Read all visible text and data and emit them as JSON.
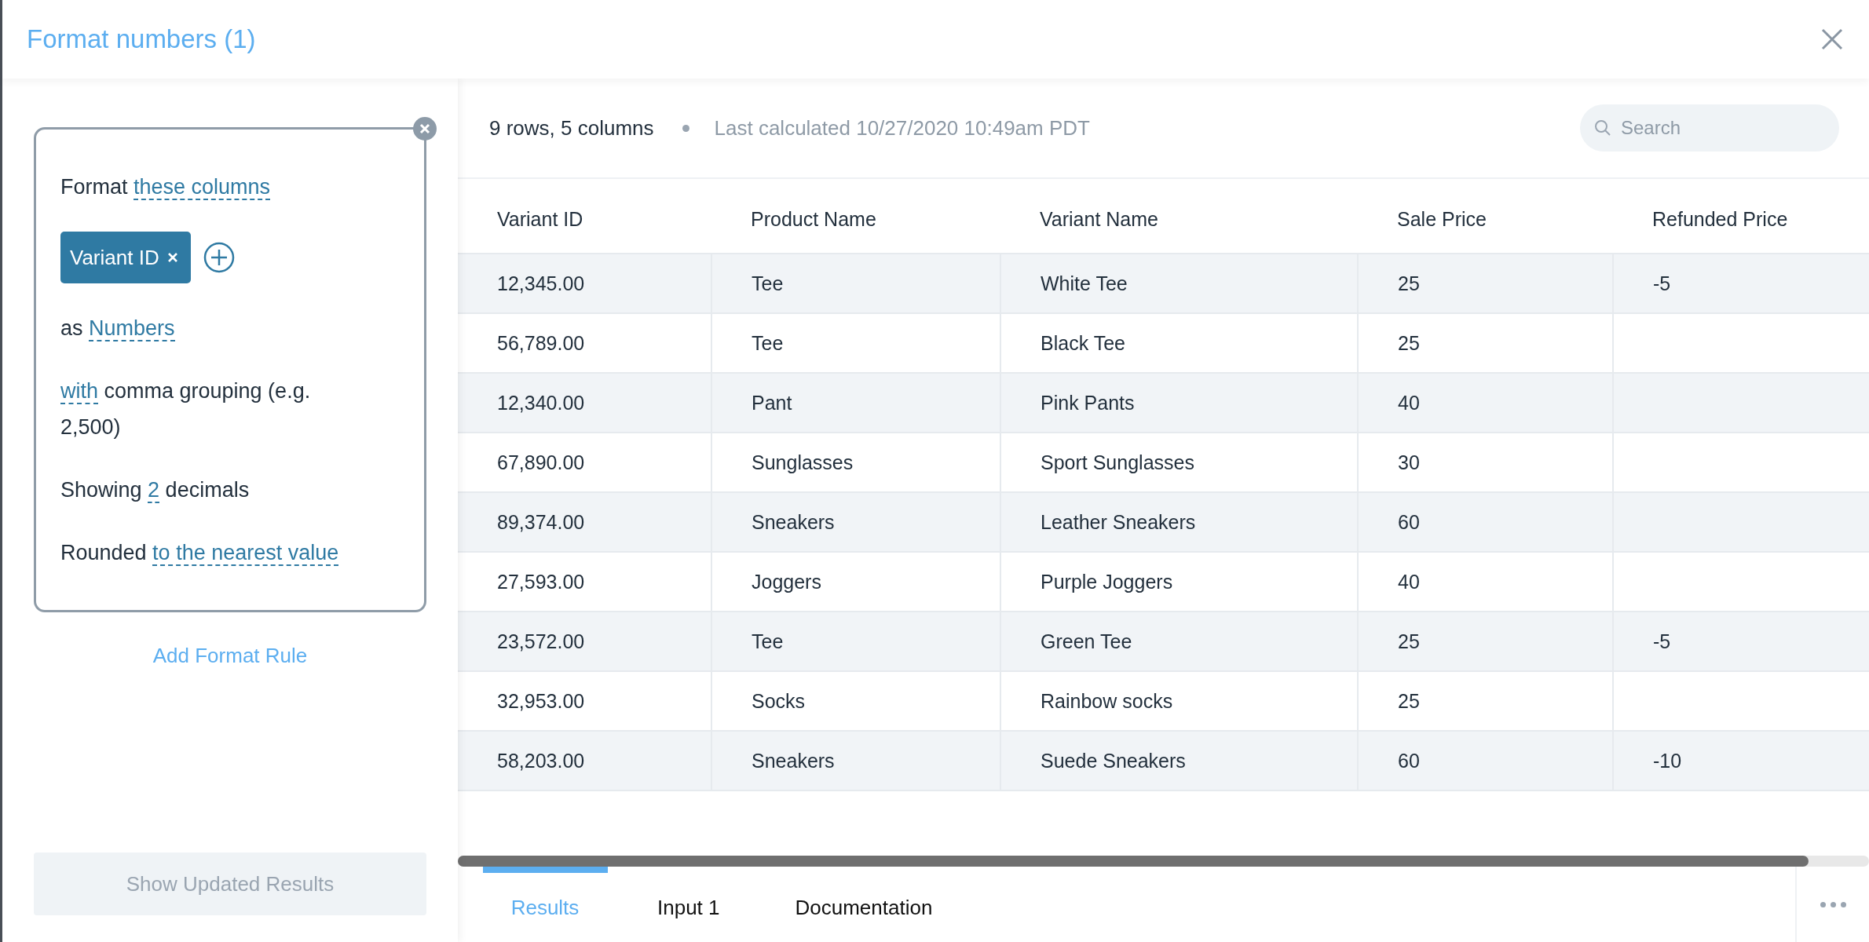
{
  "window": {
    "title": "Format numbers (1)"
  },
  "rule": {
    "lines": [
      {
        "parts": [
          {
            "text": "Format ",
            "link": false
          },
          {
            "text": "these columns",
            "link": true
          }
        ]
      },
      {
        "kind": "chips",
        "chips": [
          {
            "label": "Variant ID"
          }
        ]
      },
      {
        "parts": [
          {
            "text": "as ",
            "link": false
          },
          {
            "text": "Numbers",
            "link": true
          }
        ]
      },
      {
        "parts": [
          {
            "text": "with",
            "link": true
          },
          {
            "text": " comma grouping (e.g. 2,500)",
            "link": false
          }
        ]
      },
      {
        "parts": [
          {
            "text": "Showing ",
            "link": false
          },
          {
            "text": "2",
            "link": true
          },
          {
            "text": " decimals",
            "link": false
          }
        ]
      },
      {
        "parts": [
          {
            "text": "Rounded ",
            "link": false
          },
          {
            "text": "to the nearest value",
            "link": true
          }
        ]
      }
    ]
  },
  "add_rule": "Add Format Rule",
  "apply_button": {
    "label": "Show Updated Results",
    "disabled": true
  },
  "summary": {
    "counts": "9 rows, 5 columns",
    "calculated": "Last calculated 10/27/2020 10:49am PDT"
  },
  "search": {
    "placeholder": "Search"
  },
  "table": {
    "columns": [
      "Variant ID",
      "Product Name",
      "Variant Name",
      "Sale Price",
      "Refunded Price"
    ],
    "rows": [
      [
        "12,345.00",
        "Tee",
        "White Tee",
        "25",
        "-5"
      ],
      [
        "56,789.00",
        "Tee",
        "Black Tee",
        "25",
        ""
      ],
      [
        "12,340.00",
        "Pant",
        "Pink Pants",
        "40",
        ""
      ],
      [
        "67,890.00",
        "Sunglasses",
        "Sport Sunglasses",
        "30",
        ""
      ],
      [
        "89,374.00",
        "Sneakers",
        "Leather Sneakers",
        "60",
        ""
      ],
      [
        "27,593.00",
        "Joggers",
        "Purple Joggers",
        "40",
        ""
      ],
      [
        "23,572.00",
        "Tee",
        "Green Tee",
        "25",
        "-5"
      ],
      [
        "32,953.00",
        "Socks",
        "Rainbow socks",
        "25",
        ""
      ],
      [
        "58,203.00",
        "Sneakers",
        "Suede Sneakers",
        "60",
        "-10"
      ]
    ]
  },
  "tabs": [
    {
      "label": "Results",
      "selected": true
    },
    {
      "label": "Input 1",
      "selected": false
    },
    {
      "label": "Documentation",
      "selected": false
    }
  ]
}
